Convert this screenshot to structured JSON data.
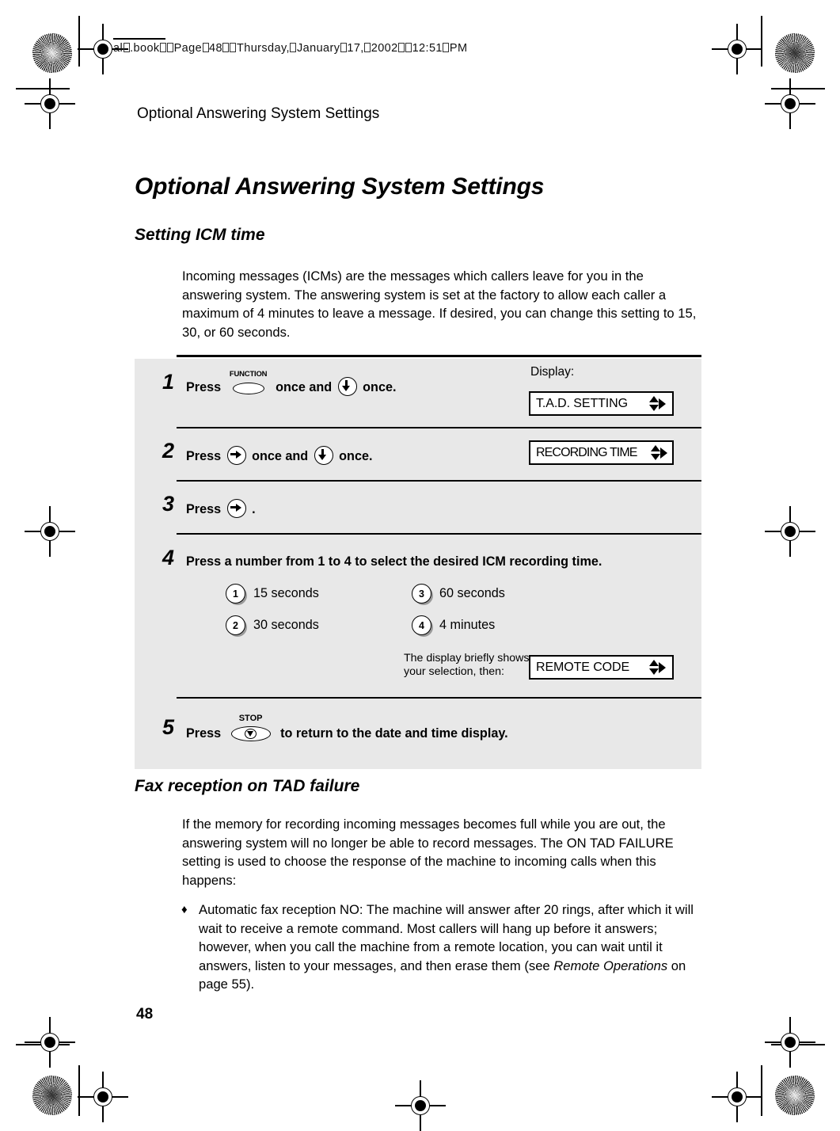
{
  "file_stamp": {
    "prefix": "al",
    "text": "al1.book  Page 48  Thursday, January 17, 2002  12:51 PM"
  },
  "running_head": "Optional Answering System Settings",
  "page_number": "48",
  "headings": {
    "title": "Optional Answering System Settings",
    "section_1": "Setting ICM time",
    "section_2": "Fax reception on TAD failure"
  },
  "paragraphs": {
    "icm_intro": "Incoming messages (ICMs) are the messages which callers leave for you in the answering system. The answering system is set at the factory to allow each caller a maximum of 4 minutes to leave a message. If desired, you can change this setting to 15, 30, or 60 seconds.",
    "tad_intro": "If the memory for recording incoming messages becomes full while you are out, the answering system will no longer be able to record messages. The ON TAD FAILURE setting is used to choose the response of the machine to incoming calls when this happens:"
  },
  "bullet": {
    "marker": "♦",
    "part1": " Automatic fax reception NO: The machine will answer after 20 rings, after which it will wait to receive a remote command. Most callers will hang up before it answers; however, when you call the machine from a remote location, you can wait until it answers, listen to your messages, and then erase them (see ",
    "italic": "Remote Operations",
    "part2": " on page 55)."
  },
  "procedure": {
    "display_label": "Display:",
    "steps": [
      {
        "number": "1",
        "text_before": "Press",
        "button_1_caption": "FUNCTION",
        "text_middle": "once and",
        "button_2": "down-arrow",
        "text_after": "once.",
        "display": "T.A.D. SETTING"
      },
      {
        "number": "2",
        "text_before": "Press",
        "button_1": "right-arrow",
        "text_middle": "once and",
        "button_2": "down-arrow",
        "text_after": "once.",
        "display": "RECORDING TIME"
      },
      {
        "number": "3",
        "text_before": "Press",
        "button_1": "right-arrow",
        "text_after": "."
      },
      {
        "number": "4",
        "text": "Press a number from 1 to 4 to select the desired ICM recording time.",
        "options": [
          {
            "key": "1",
            "label": "15 seconds"
          },
          {
            "key": "2",
            "label": "30 seconds"
          },
          {
            "key": "3",
            "label": "60 seconds"
          },
          {
            "key": "4",
            "label": "4 minutes"
          }
        ],
        "brief_note": "The display briefly shows your selection, then:",
        "display": "REMOTE CODE"
      },
      {
        "number": "5",
        "text_before": "Press",
        "button_1_caption": "STOP",
        "text_after": "to return to the date and time display."
      }
    ]
  },
  "colors": {
    "panel_background": "#e8e8e8",
    "page_background": "#ffffff",
    "ink": "#000000"
  }
}
